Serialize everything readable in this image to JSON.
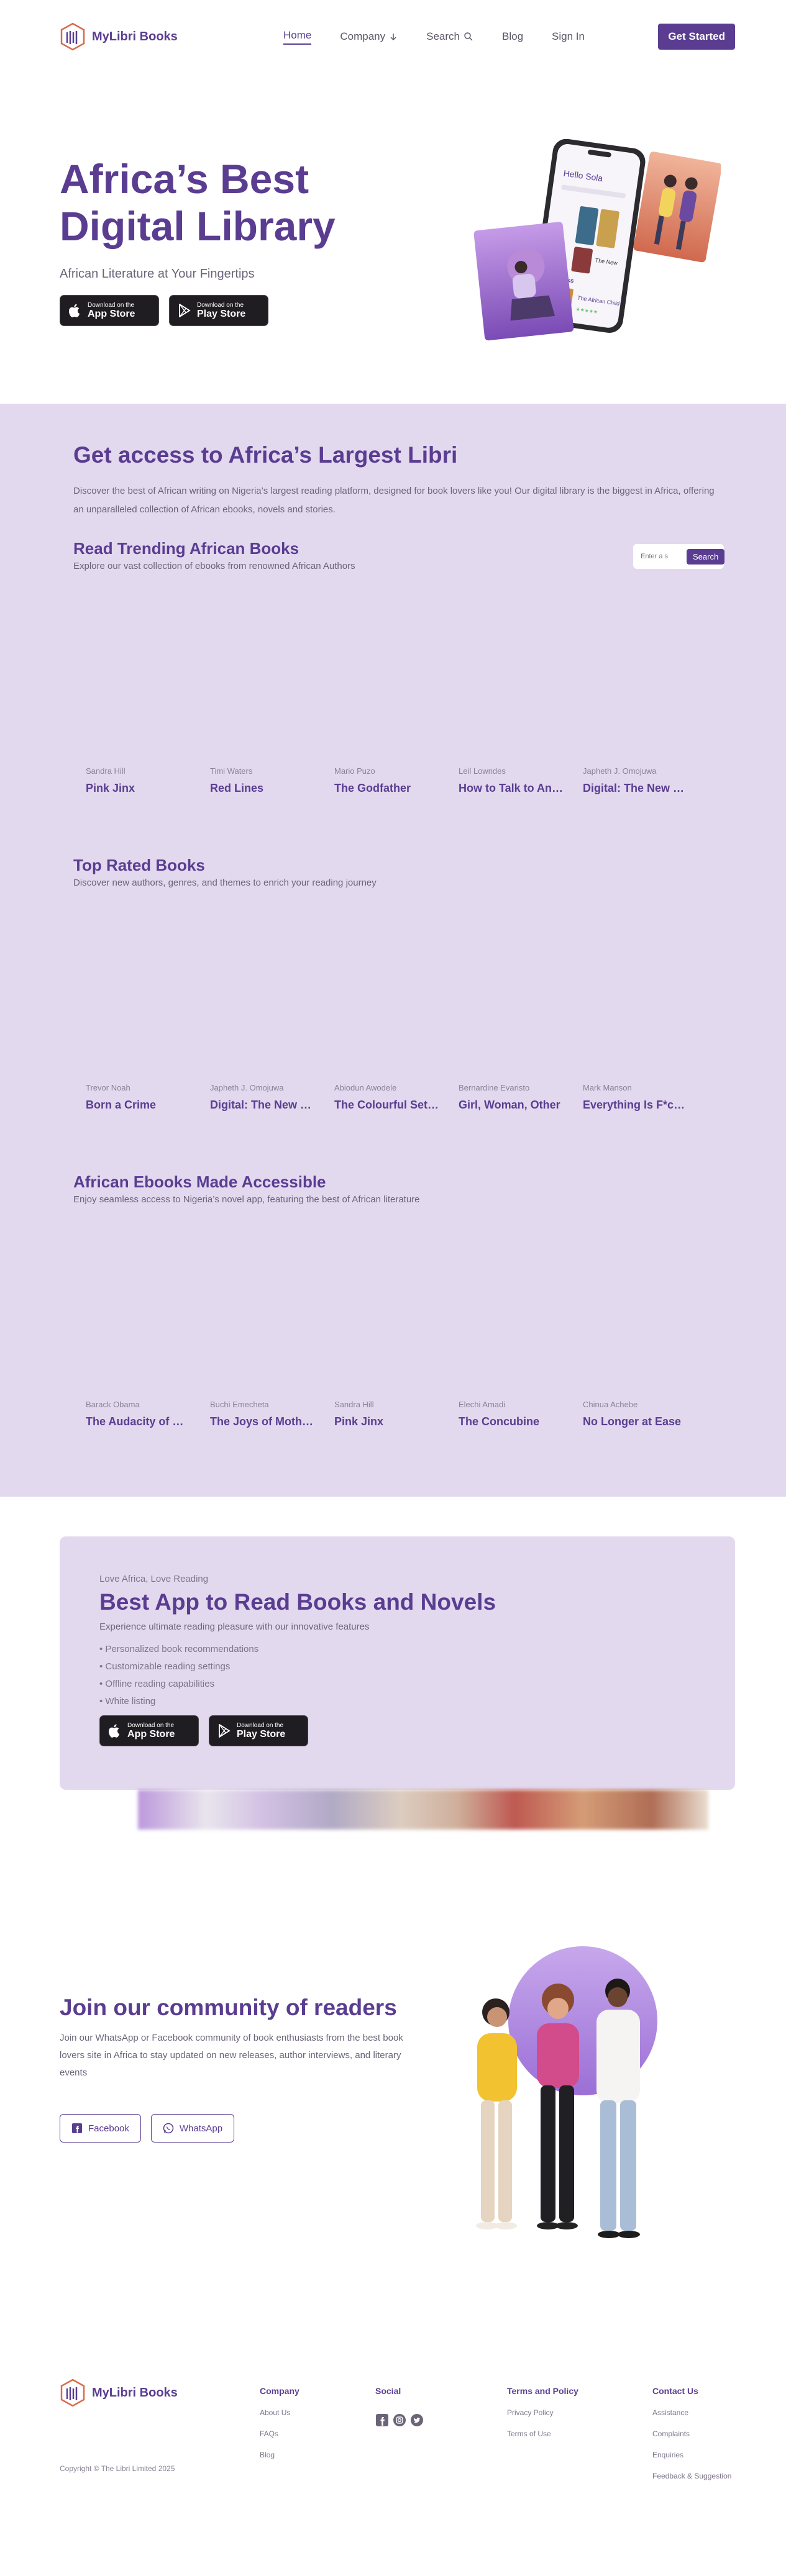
{
  "brand": {
    "name": "MyLibri Books",
    "color": "#5a3d91",
    "tint": "#e3d9ef"
  },
  "nav": {
    "home": "Home",
    "company": "Company",
    "search": "Search",
    "blog": "Blog",
    "signin": "Sign In",
    "cta": "Get Started"
  },
  "hero": {
    "title": "Africa’s Best Digital Library",
    "subtitle": "African Literature at Your Fingertips",
    "app_store_small": "Download on the",
    "app_store_big": "App Store",
    "play_store_small": "Download on the",
    "play_store_big": "Play Store",
    "phone_greeting": "Hello Sola",
    "phone_book": "The African Child",
    "phone_books_label": "Books",
    "phone_card_label": "The New"
  },
  "library": {
    "title": "Get access to Africa’s Largest Libri",
    "description": "Discover the best of African writing on Nigeria’s largest reading platform, designed for book lovers like you! Our digital library is the biggest in Africa, offering an unparalleled collection of African ebooks, novels and stories.",
    "search_placeholder": "Enter a s",
    "search_button": "Search",
    "shelves": [
      {
        "title": "Read Trending African Books",
        "subtitle": "Explore our vast collection of ebooks from renowned African Authors",
        "books": [
          {
            "author": "Sandra Hill",
            "title": "Pink Jinx"
          },
          {
            "author": "Timi Waters",
            "title": "Red Lines"
          },
          {
            "author": "Mario Puzo",
            "title": "The Godfather"
          },
          {
            "author": "Leil Lowndes",
            "title": "How to Talk to Anyone"
          },
          {
            "author": "Japheth J. Omojuwa",
            "title": "Digital: The New Code of Wealth"
          }
        ]
      },
      {
        "title": "Top Rated Books",
        "subtitle": "Discover new authors, genres, and themes to enrich your reading journey",
        "books": [
          {
            "author": "Trevor Noah",
            "title": "Born a Crime"
          },
          {
            "author": "Japheth J. Omojuwa",
            "title": "Digital: The New Code of Wealth"
          },
          {
            "author": "Abiodun Awodele",
            "title": "The Colourful Setting Sun"
          },
          {
            "author": "Bernardine Evaristo",
            "title": "Girl, Woman, Other"
          },
          {
            "author": "Mark Manson",
            "title": "Everything Is F*cked"
          }
        ]
      },
      {
        "title": "African Ebooks Made Accessible",
        "subtitle": "Enjoy seamless access to Nigeria’s novel app, featuring the best of African literature",
        "books": [
          {
            "author": "Barack Obama",
            "title": "The Audacity of Hope"
          },
          {
            "author": "Buchi Emecheta",
            "title": "The Joys of Motherhood"
          },
          {
            "author": "Sandra Hill",
            "title": "Pink Jinx"
          },
          {
            "author": "Elechi Amadi",
            "title": "The Concubine"
          },
          {
            "author": "Chinua Achebe",
            "title": "No Longer at Ease"
          }
        ]
      }
    ]
  },
  "promo": {
    "kicker": "Love Africa, Love Reading",
    "title": "Best App to Read Books and Novels",
    "subtitle": "Experience ultimate reading pleasure with our innovative features",
    "features": [
      "• Personalized book recommendations",
      "• Customizable reading settings",
      "• Offline reading capabilities",
      "• White listing"
    ],
    "app_store_small": "Download on the",
    "app_store_big": "App Store",
    "play_store_small": "Download on the",
    "play_store_big": "Play Store"
  },
  "community": {
    "title": "Join our community of readers",
    "description": "Join our WhatsApp or Facebook community of book enthusiasts from the best book lovers site in Africa to stay updated on new releases, author interviews, and literary events",
    "facebook": "Facebook",
    "whatsapp": "WhatsApp"
  },
  "footer": {
    "company_head": "Company",
    "company_items": [
      "About Us",
      "FAQs",
      "Blog"
    ],
    "social_head": "Social",
    "terms_head": "Terms and Policy",
    "terms_items": [
      "Privacy Policy",
      "Terms of Use"
    ],
    "contact_head": "Contact Us",
    "contact_items": [
      "Assistance",
      "Complaints",
      "Enquiries",
      "Feedback & Suggestion"
    ],
    "copyright": "Copyright © The Libri Limited 2025"
  },
  "icons": [
    "chevron-down-icon",
    "search-icon",
    "apple-icon",
    "play-icon",
    "facebook-icon",
    "whatsapp-icon",
    "instagram-icon",
    "twitter-icon"
  ]
}
